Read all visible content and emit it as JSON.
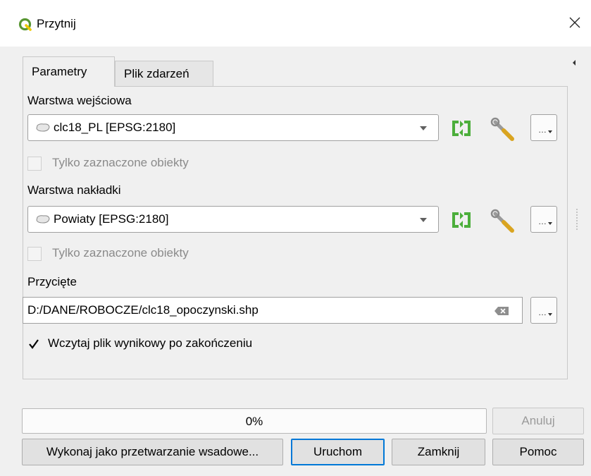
{
  "window": {
    "title": "Przytnij"
  },
  "tabs": [
    {
      "label": "Parametry",
      "active": true
    },
    {
      "label": "Plik zdarzeń",
      "active": false
    }
  ],
  "input_layer": {
    "label": "Warstwa wejściowa",
    "value": "clc18_PL [EPSG:2180]",
    "selected_only_label": "Tylko zaznaczone obiekty"
  },
  "overlay_layer": {
    "label": "Warstwa nakładki",
    "value": "Powiaty [EPSG:2180]",
    "selected_only_label": "Tylko zaznaczone obiekty"
  },
  "output": {
    "label": "Przycięte",
    "value": "D:/DANE/ROBOCZE/clc18_opoczynski.shp",
    "load_result_label": "Wczytaj plik wynikowy po zakończeniu",
    "load_result_checked": true
  },
  "icons": {
    "app": "qgis-logo-icon",
    "iterate": "iterate-icon",
    "settings": "wrench-icon",
    "browse": "ellipsis-dropdown-icon",
    "clear": "clear-icon",
    "close": "close-icon"
  },
  "progress": {
    "text": "0%",
    "value": 0
  },
  "buttons": {
    "cancel": "Anuluj",
    "batch": "Wykonaj jako przetwarzanie wsadowe...",
    "run": "Uruchom",
    "close": "Zamknij",
    "help": "Pomoc"
  },
  "colors": {
    "accent": "#0078d7",
    "iterate_green": "#4cae3b",
    "progress_fill": "#06b025"
  }
}
